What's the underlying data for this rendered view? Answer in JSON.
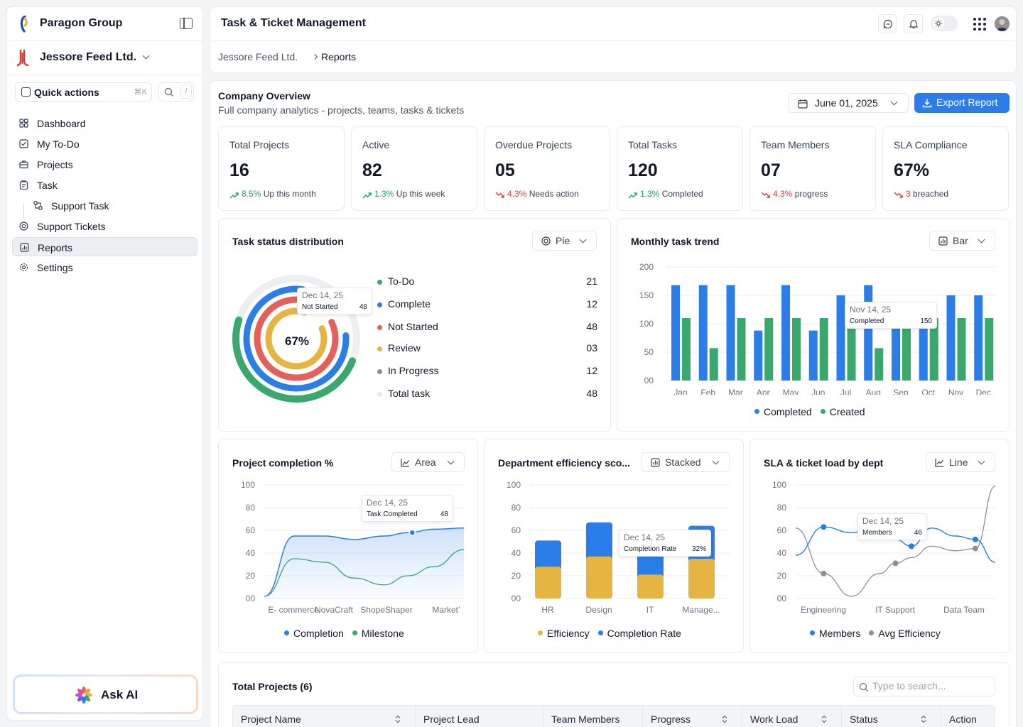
{
  "sidebar": {
    "org_name": "Paragon Group",
    "workspace": "Jessore Feed Ltd.",
    "quick_actions": "Quick actions",
    "quick_shortcut": "⌘K",
    "search_shortcut": "/",
    "nav": [
      {
        "label": "Dashboard",
        "icon": "dashboard-icon"
      },
      {
        "label": "My To-Do",
        "icon": "checkbox-icon"
      },
      {
        "label": "Projects",
        "icon": "briefcase-icon"
      },
      {
        "label": "Task",
        "icon": "clipboard-icon"
      },
      {
        "label": "Support Task",
        "icon": "workflow-icon"
      },
      {
        "label": "Support Tickets",
        "icon": "lifebuoy-icon"
      },
      {
        "label": "Reports",
        "icon": "report-icon"
      },
      {
        "label": "Settings",
        "icon": "gear-icon"
      }
    ],
    "ask_ai": "Ask AI"
  },
  "topbar": {
    "title": "Task & Ticket Management",
    "breadcrumb": [
      "Jessore Feed Ltd.",
      "Reports"
    ]
  },
  "overview": {
    "title": "Company Overview",
    "subtitle": "Full company analytics - projects, teams, tasks & tickets",
    "date": "June 01, 2025",
    "export": "Export Report"
  },
  "kpis": [
    {
      "label": "Total Projects",
      "value": "16",
      "delta": "8.5%",
      "trend": "up",
      "note": "Up this month"
    },
    {
      "label": "Active",
      "value": "82",
      "delta": "1.3%",
      "trend": "up",
      "note": "Up this week"
    },
    {
      "label": "Overdue Projects",
      "value": "05",
      "delta": "4.3%",
      "trend": "down",
      "note": "Needs action"
    },
    {
      "label": "Total Tasks",
      "value": "120",
      "delta": "1.3%",
      "trend": "up",
      "note": "Completed"
    },
    {
      "label": "Team Members",
      "value": "07",
      "delta": "4.3%",
      "trend": "down",
      "note": "progress"
    },
    {
      "label": "SLA Compliance",
      "value": "67%",
      "delta": "3",
      "trend": "down",
      "note": "breached"
    }
  ],
  "colors": {
    "blue": "#2b7de9",
    "green": "#3aa76d",
    "red": "#e5605a",
    "yellow": "#e6b541",
    "gray": "#8a8f98",
    "light": "#eceef1",
    "up": "#22a06b",
    "down": "#e0393e"
  },
  "task_status": {
    "title": "Task status distribution",
    "selector": "Pie",
    "center": "67%",
    "tooltip": {
      "date": "Dec 14, 25",
      "key": "Not Started",
      "value": "48"
    },
    "items": [
      {
        "label": "To-Do",
        "value": "21",
        "color": "#3aa76d"
      },
      {
        "label": "Complete",
        "value": "12",
        "color": "#2b7de9"
      },
      {
        "label": "Not Started",
        "value": "48",
        "color": "#e5605a"
      },
      {
        "label": "Review",
        "value": "03",
        "color": "#e6b541"
      },
      {
        "label": "In Progress",
        "value": "12",
        "color": "#8a8f98"
      },
      {
        "label": "Total task",
        "value": "48",
        "color": "#e5e7eb"
      }
    ]
  },
  "monthly": {
    "title": "Monthly task trend",
    "selector": "Bar",
    "tooltip": {
      "date": "Nov 14, 25",
      "key": "Completed",
      "value": "150"
    },
    "legend": [
      "Completed",
      "Created"
    ]
  },
  "project_completion": {
    "title": "Project completion %",
    "selector": "Area",
    "tooltip": {
      "date": "Dec 14, 25",
      "key": "Task Completed",
      "value": "48"
    },
    "legend": [
      "Completion",
      "Milestone"
    ]
  },
  "dept_eff": {
    "title": "Department efficiency sco...",
    "selector": "Stacked",
    "tooltip": {
      "date": "Dec 14, 25",
      "key": "Completion Rate",
      "value": "32%"
    },
    "legend": [
      "Efficiency",
      "Completion Rate"
    ]
  },
  "sla": {
    "title": "SLA & ticket load by dept",
    "selector": "Line",
    "tooltip": {
      "date": "Dec 14, 25",
      "key": "Members",
      "value": "46"
    },
    "legend": [
      "Members",
      "Avg Efficiency"
    ]
  },
  "chart_data": [
    {
      "type": "pie",
      "title": "Task status distribution",
      "categories": [
        "To-Do",
        "Complete",
        "Not Started",
        "Review",
        "In Progress",
        "Total task"
      ],
      "values": [
        21,
        12,
        48,
        3,
        12,
        48
      ],
      "center_label": "67%"
    },
    {
      "type": "bar",
      "title": "Monthly task trend",
      "categories": [
        "Jan",
        "Feb",
        "Mar",
        "Apr",
        "May",
        "Jun",
        "Jul",
        "Aug",
        "Sep",
        "Oct",
        "Nov",
        "Dec"
      ],
      "ylim": [
        0,
        200
      ],
      "yticks": [
        "200",
        "150",
        "100",
        "50",
        "00"
      ],
      "series": [
        {
          "name": "Completed",
          "values": [
            168,
            168,
            168,
            88,
            168,
            88,
            150,
            168,
            132,
            110,
            150,
            150
          ]
        },
        {
          "name": "Created",
          "values": [
            110,
            57,
            110,
            110,
            110,
            110,
            110,
            57,
            110,
            110,
            110,
            110
          ]
        }
      ]
    },
    {
      "type": "area",
      "title": "Project completion %",
      "categories": [
        "E- commerce",
        "NovaCraft",
        "ShopeShaper",
        "Market’"
      ],
      "ylim": [
        0,
        100
      ],
      "yticks": [
        "100",
        "80",
        "60",
        "40",
        "20",
        "00"
      ],
      "x": [
        0,
        0.15,
        0.3,
        0.45,
        0.6,
        0.72,
        0.85,
        1.0
      ],
      "series": [
        {
          "name": "Completion",
          "values": [
            2,
            55,
            55,
            52,
            55,
            58,
            61,
            62
          ]
        },
        {
          "name": "Milestone",
          "values": [
            2,
            35,
            32,
            18,
            12,
            20,
            28,
            43
          ]
        }
      ]
    },
    {
      "type": "bar",
      "title": "Department efficiency sco...",
      "categories": [
        "HR",
        "Design",
        "IT",
        "Manage..."
      ],
      "ylim": [
        0,
        100
      ],
      "yticks": [
        "100",
        "80",
        "60",
        "40",
        "20",
        "00"
      ],
      "series": [
        {
          "name": "Efficiency",
          "values": [
            28,
            37,
            21,
            35
          ]
        },
        {
          "name": "Completion Rate",
          "values": [
            23,
            30,
            37,
            29
          ]
        }
      ]
    },
    {
      "type": "line",
      "title": "SLA & ticket load by dept",
      "categories": [
        "Engineering",
        "IT Support",
        "Data Team"
      ],
      "ylim": [
        0,
        100
      ],
      "yticks": [
        "100",
        "80",
        "60",
        "40",
        "20",
        "00"
      ],
      "x": [
        0,
        0.14,
        0.28,
        0.42,
        0.5,
        0.58,
        0.68,
        0.8,
        0.9,
        1.0
      ],
      "series": [
        {
          "name": "Members",
          "values": [
            38,
            63,
            58,
            65,
            52,
            46,
            62,
            55,
            52,
            32
          ]
        },
        {
          "name": "Avg Efficiency",
          "values": [
            62,
            22,
            2,
            22,
            31,
            36,
            46,
            42,
            44,
            99
          ]
        }
      ]
    }
  ],
  "table": {
    "title": "Total Projects (6)",
    "search_placeholder": "Type to search...",
    "columns": [
      "Project Name",
      "Project Lead",
      "Team Members",
      "Progress",
      "Work Load",
      "Status",
      "Action"
    ]
  }
}
